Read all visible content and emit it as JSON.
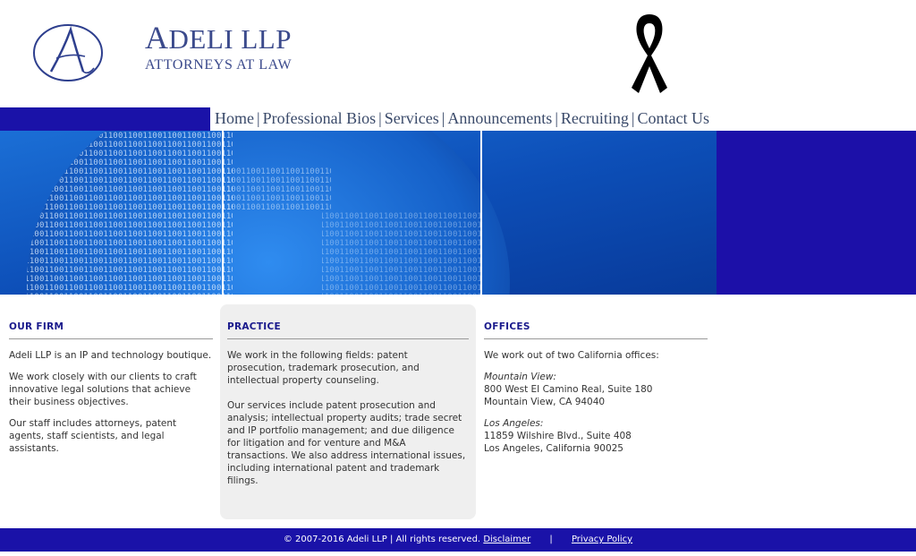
{
  "header": {
    "brand_initial": "A",
    "brand_rest": "DELI LLP",
    "tagline": "ATTORNEYS AT LAW"
  },
  "nav": {
    "items": [
      "Home",
      "Professional Bios",
      "Services",
      "Announcements",
      "Recruiting",
      "Contact Us"
    ],
    "separator": "|"
  },
  "firm": {
    "heading": "OUR FIRM",
    "p1": "Adeli LLP is an IP and technology boutique.",
    "p2": "We work closely with our clients to craft innovative legal solutions that achieve their business objectives.",
    "p3": "Our staff includes attorneys, patent agents, staff scientists, and legal assistants."
  },
  "practice": {
    "heading": "PRACTICE",
    "p1": "We work in the following fields: patent prosecution, trademark prosecution, and intellectual property counseling.",
    "p2": "Our services include patent prosecution and analysis; intellectual property audits; trade secret and IP portfolio management; and due diligence for litigation and for venture and M&A transactions.  We also address international issues, including international patent and trademark filings."
  },
  "offices": {
    "heading": "OFFICES",
    "intro": "We work out of two California offices:",
    "mv_city": "Mountain View:",
    "mv_line1": "800 West EI Camino Real, Suite 180",
    "mv_line2": "Mountain View, CA 94040",
    "la_city": "Los Angeles:",
    "la_line1": "11859 Wilshire Blvd., Suite 408",
    "la_line2": "Los Angeles, California 90025"
  },
  "footer": {
    "copyright": "© 2007-2016 Adeli LLP | All rights reserved.",
    "disclaimer": "Disclaimer",
    "separator": "|",
    "privacy": "Privacy Policy"
  },
  "colors": {
    "brand_blue": "#1a12a8",
    "text_navy": "#3b4a8c"
  },
  "icons": {
    "logo": "adeli-logo-icon",
    "ribbon": "black-ribbon-icon"
  }
}
